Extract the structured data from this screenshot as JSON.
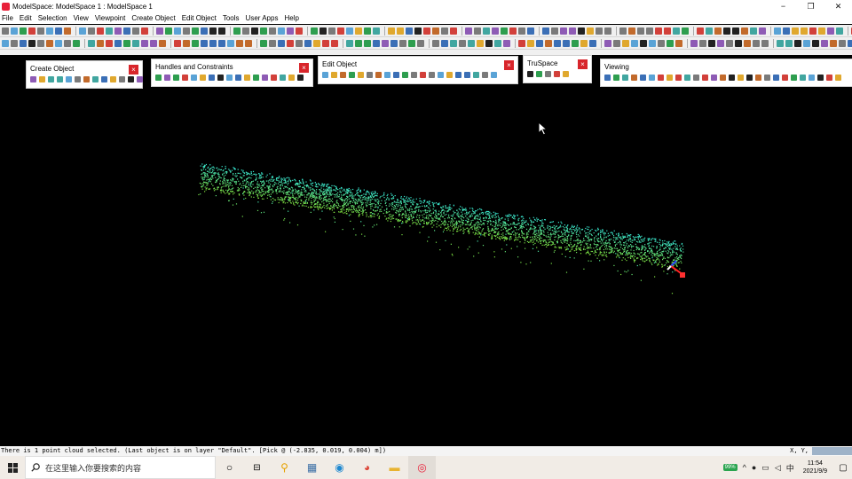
{
  "window": {
    "title": "ModelSpace: ModelSpace 1 : ModelSpace 1",
    "minimize": "−",
    "restore": "❐",
    "close": "✕"
  },
  "menu": [
    "File",
    "Edit",
    "Selection",
    "View",
    "Viewpoint",
    "Create Object",
    "Edit Object",
    "Tools",
    "User Apps",
    "Help"
  ],
  "panels": {
    "create_object": "Create Object",
    "handles_constraints": "Handles and Constraints",
    "edit_object": "Edit Object",
    "truspace": "TruSpace",
    "viewing": "Viewing",
    "close_glyph": "×"
  },
  "status": {
    "message": "There is 1 point cloud selected. (Last object is on layer \"Default\". [Pick @ (-2.835, 0.019, 0.004) m])",
    "x_label": "X,",
    "y_label": "Y,"
  },
  "taskbar": {
    "search_placeholder": "在这里输入你要搜索的内容",
    "battery": "99%",
    "ime": "中",
    "time": "11:54",
    "date": "2021/9/9"
  },
  "colors": {
    "accent": "#e8213a",
    "cloud_cyan": "#37e6d2",
    "cloud_green": "#6fe04a"
  }
}
